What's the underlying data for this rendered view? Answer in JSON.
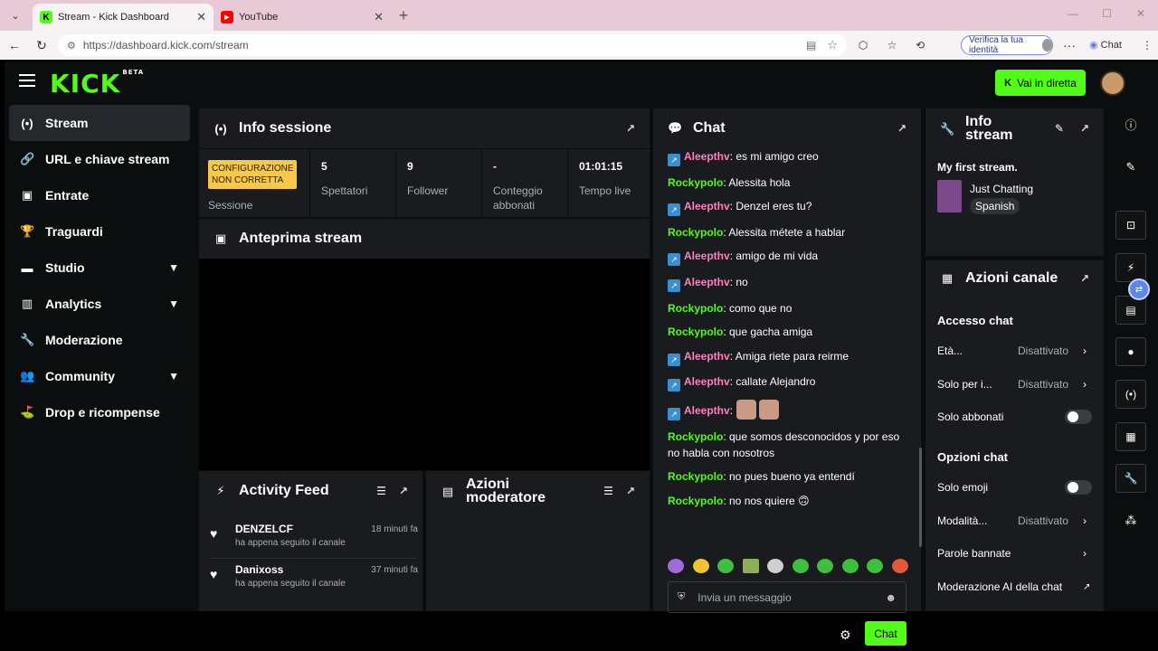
{
  "browser": {
    "tabs": [
      {
        "title": "Stream - Kick Dashboard",
        "favicon": "kick-icon"
      },
      {
        "title": "YouTube",
        "favicon": "youtube-icon"
      }
    ],
    "url": "https://dashboard.kick.com/stream",
    "verify_label": "Verifica la tua identità",
    "copilot_label": "Chat"
  },
  "topbar": {
    "logo": "KICK",
    "logo_beta": "BETA",
    "go_live": "Vai in diretta"
  },
  "sidebar": {
    "items": [
      {
        "label": "Stream",
        "icon": "stream-icon"
      },
      {
        "label": "URL e chiave stream",
        "icon": "link-icon"
      },
      {
        "label": "Entrate",
        "icon": "wallet-icon"
      },
      {
        "label": "Traguardi",
        "icon": "trophy-icon"
      },
      {
        "label": "Studio",
        "icon": "studio-icon"
      },
      {
        "label": "Analytics",
        "icon": "chart-icon"
      },
      {
        "label": "Moderazione",
        "icon": "wrench-icon"
      },
      {
        "label": "Community",
        "icon": "users-icon"
      },
      {
        "label": "Drop e ricompense",
        "icon": "drops-icon"
      }
    ]
  },
  "session": {
    "title": "Info sessione",
    "badge": "CONFIGURAZIONE NON CORRETTA",
    "session_label": "Sessione",
    "stats": [
      {
        "value": "5",
        "label": "Spettatori"
      },
      {
        "value": "9",
        "label": "Follower"
      },
      {
        "value": "-",
        "label": "Conteggio abbonati"
      },
      {
        "value": "01:01:15",
        "label": "Tempo live"
      }
    ]
  },
  "preview": {
    "title": "Anteprima stream"
  },
  "activity": {
    "title": "Activity Feed",
    "items": [
      {
        "name": "DENZELCF",
        "time": "18 minuti fa",
        "desc": "ha appena seguito il canale"
      },
      {
        "name": "Danixoss",
        "time": "37 minuti fa",
        "desc": "ha appena seguito il canale"
      }
    ]
  },
  "modactions": {
    "title_line1": "Azioni",
    "title_line2": "moderatore"
  },
  "chat": {
    "title": "Chat",
    "messages": [
      {
        "user": "Aleepthv",
        "text": ": es mi amigo creo"
      },
      {
        "user": "Rockypolo",
        "text": ": Alessita hola"
      },
      {
        "user": "Aleepthv",
        "text": ": Denzel eres tu?"
      },
      {
        "user": "Rockypolo",
        "text": ": Alessita métete a hablar"
      },
      {
        "user": "Aleepthv",
        "text": ": amigo de mi vida"
      },
      {
        "user": "Aleepthv",
        "text": ": no"
      },
      {
        "user": "Rockypolo",
        "text": ": como que no"
      },
      {
        "user": "Rockypolo",
        "text": ": que gacha amiga"
      },
      {
        "user": "Aleepthv",
        "text": ": Amiga riete para reirme"
      },
      {
        "user": "Aleepthv",
        "text": ": callate Alejandro"
      },
      {
        "user": "Aleepthv",
        "text": ":"
      },
      {
        "user": "Rockypolo",
        "text": ": que somos desconocidos y por eso no habla con nosotros"
      },
      {
        "user": "Rockypolo",
        "text": ": no pues bueno ya entendí"
      },
      {
        "user": "Rockypolo",
        "text": ": no nos quiere 🙃"
      }
    ],
    "input_placeholder": "Invia un messaggio",
    "send_label": "Chat"
  },
  "stream_info": {
    "title_line1": "Info",
    "title_line2": "stream",
    "stream_title": "My first stream.",
    "category": "Just Chatting",
    "language": "Spanish"
  },
  "channel_actions": {
    "title": "Azioni canale",
    "chat_access_title": "Accesso chat",
    "age_label": "Età...",
    "age_value": "Disattivato",
    "followers_label": "Solo per i...",
    "followers_value": "Disattivato",
    "subs_label": "Solo abbonati",
    "chat_options_title": "Opzioni chat",
    "emoji_label": "Solo emoji",
    "slow_label": "Modalità...",
    "slow_value": "Disattivato",
    "banned_words_label": "Parole bannate",
    "ai_mod_label": "Moderazione AI della chat"
  }
}
